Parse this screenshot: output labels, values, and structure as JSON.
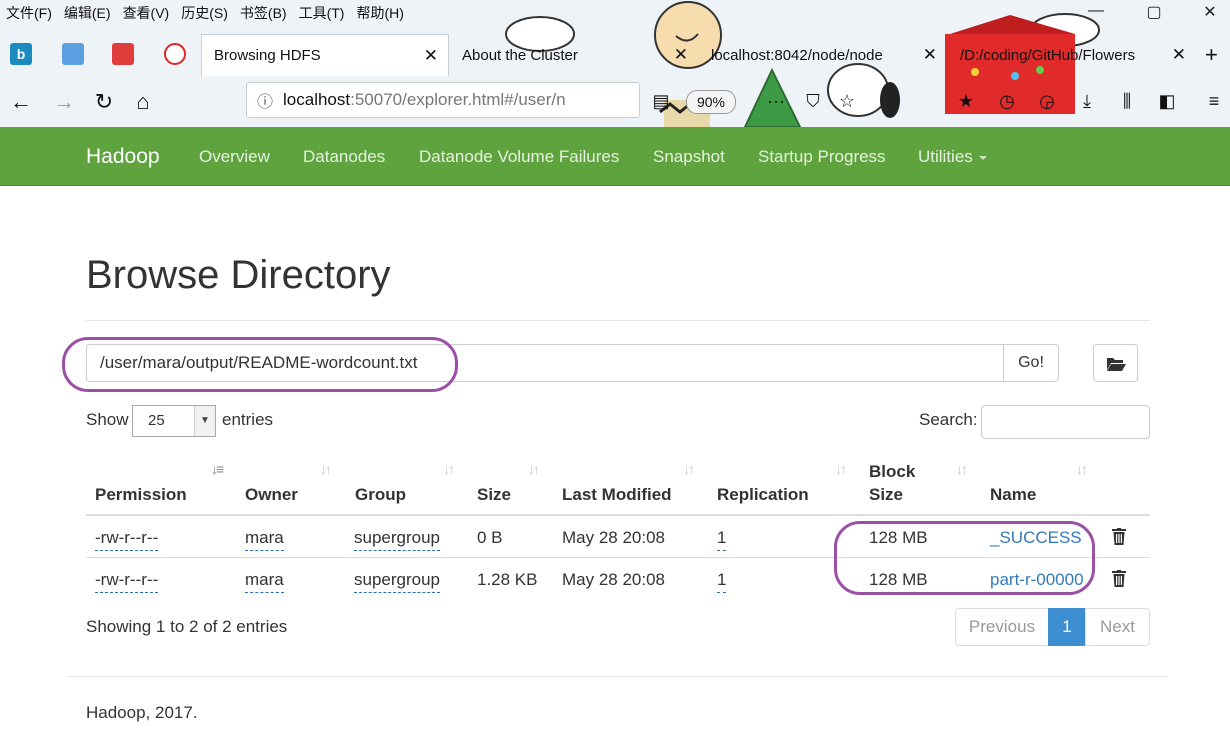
{
  "browser": {
    "menu": [
      "文件(F)",
      "编辑(E)",
      "查看(V)",
      "历史(S)",
      "书签(B)",
      "工具(T)",
      "帮助(H)"
    ],
    "window_controls": {
      "minimize": "—",
      "maximize": "▢",
      "close": "✕"
    },
    "tabs": [
      {
        "title": "Browsing HDFS",
        "active": true
      },
      {
        "title": "About the Cluster",
        "active": false
      },
      {
        "title": "localhost:8042/node/node",
        "active": false
      },
      {
        "title": "/D:/coding/GitHub/Flowers",
        "active": false
      }
    ],
    "new_tab": "+",
    "url_host": "localhost",
    "url_path": ":50070/explorer.html#/user/n",
    "zoom": "90%"
  },
  "hnav": {
    "brand": "Hadoop",
    "links": [
      "Overview",
      "Datanodes",
      "Datanode Volume Failures",
      "Snapshot",
      "Startup Progress",
      "Utilities"
    ]
  },
  "page": {
    "title": "Browse Directory",
    "path_value": "/user/mara/output/README-wordcount.txt",
    "go_label": "Go!",
    "show_label": "Show",
    "entries_label": "entries",
    "page_size": "25",
    "search_label": "Search:",
    "columns": [
      "Permission",
      "Owner",
      "Group",
      "Size",
      "Last Modified",
      "Replication",
      "Block",
      "Size",
      "Name"
    ],
    "rows": [
      {
        "permission": "-rw-r--r--",
        "owner": "mara",
        "group": "supergroup",
        "size": "0 B",
        "modified": "May 28 20:08",
        "replication": "1",
        "block_size": "128 MB",
        "name": "_SUCCESS"
      },
      {
        "permission": "-rw-r--r--",
        "owner": "mara",
        "group": "supergroup",
        "size": "1.28 KB",
        "modified": "May 28 20:08",
        "replication": "1",
        "block_size": "128 MB",
        "name": "part-r-00000"
      }
    ],
    "info": "Showing 1 to 2 of 2 entries",
    "pager": {
      "previous": "Previous",
      "current": "1",
      "next": "Next"
    },
    "footer": "Hadoop, 2017."
  },
  "colors": {
    "navbar": "#5fa33e",
    "annotation": "#9b4fa6",
    "link": "#337ab7",
    "active_page": "#3d8fd1"
  }
}
